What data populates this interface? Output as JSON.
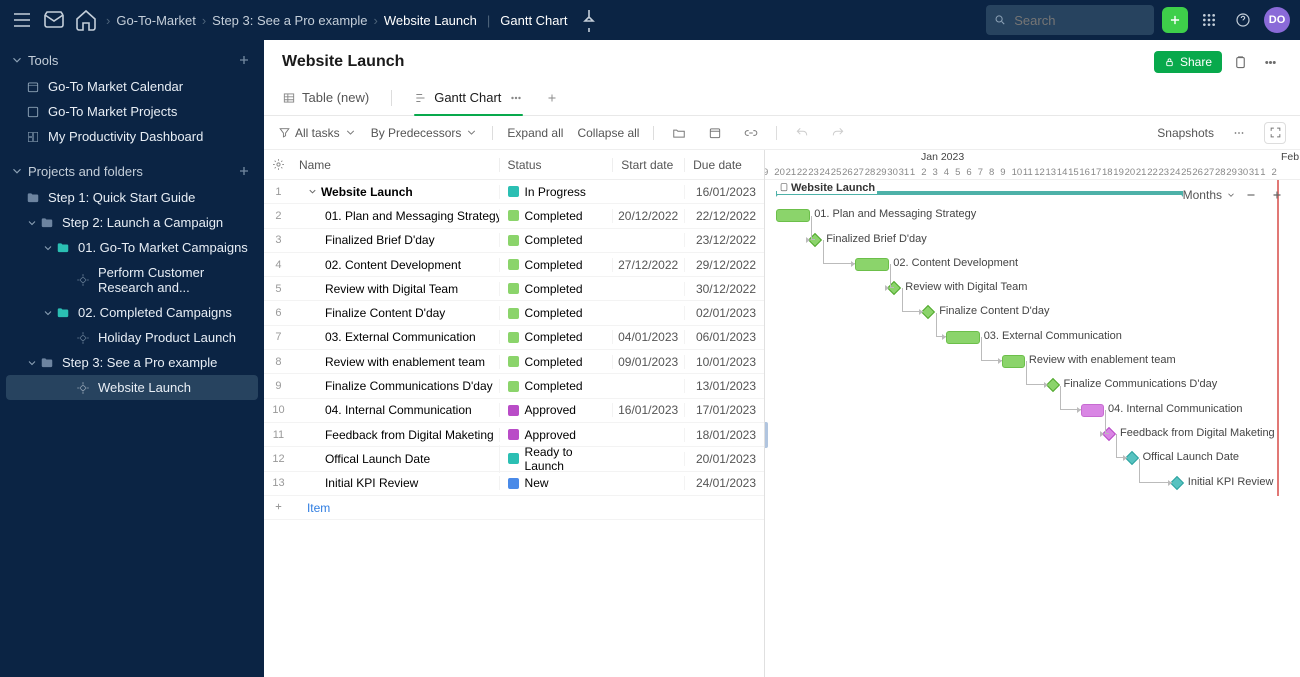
{
  "topbar": {
    "breadcrumbs": [
      "Go-To-Market",
      "Step 3: See a Pro example",
      "Website Launch"
    ],
    "view_divider": "|",
    "view_name": "Gantt Chart",
    "search_placeholder": "Search",
    "avatar_initials": "DO"
  },
  "sidebar": {
    "tools_label": "Tools",
    "tools_items": [
      "Go-To Market Calendar",
      "Go-To Market Projects",
      "My Productivity Dashboard"
    ],
    "projects_label": "Projects and folders",
    "step1": "Step 1: Quick Start Guide",
    "step2": "Step 2: Launch a Campaign",
    "step2_sub1": "01. Go-To Market Campaigns",
    "step2_sub1a": "Perform Customer Research and...",
    "step2_sub2": "02. Completed Campaigns",
    "step2_sub2a": "Holiday Product Launch",
    "step3": "Step 3: See a Pro example",
    "step3_sub1": "Website Launch"
  },
  "page": {
    "title": "Website Launch",
    "share_label": "Share",
    "tabs": {
      "table": "Table (new)",
      "gantt": "Gantt Chart"
    }
  },
  "toolbar": {
    "all_tasks": "All tasks",
    "by_pred": "By Predecessors",
    "expand_all": "Expand all",
    "collapse_all": "Collapse all",
    "snapshots": "Snapshots"
  },
  "grid_headers": {
    "name": "Name",
    "status": "Status",
    "start": "Start date",
    "due": "Due date"
  },
  "status_colors": {
    "In Progress": "#2bbfb3",
    "Completed": "#8bd46b",
    "Approved": "#b94cc7",
    "Ready to Launch": "#2bbfb3",
    "New": "#4a8ae8"
  },
  "rows": [
    {
      "n": 1,
      "name": "Website Launch",
      "status": "In Progress",
      "start": "",
      "due": "16/01/2023",
      "indent": 0,
      "parent": true
    },
    {
      "n": 2,
      "name": "01. Plan and Messaging Strategy",
      "status": "Completed",
      "start": "20/12/2022",
      "due": "22/12/2022",
      "indent": 1
    },
    {
      "n": 3,
      "name": "Finalized Brief D'day",
      "status": "Completed",
      "start": "",
      "due": "23/12/2022",
      "indent": 1
    },
    {
      "n": 4,
      "name": "02. Content Development",
      "status": "Completed",
      "start": "27/12/2022",
      "due": "29/12/2022",
      "indent": 1
    },
    {
      "n": 5,
      "name": "Review with Digital Team",
      "status": "Completed",
      "start": "",
      "due": "30/12/2022",
      "indent": 1
    },
    {
      "n": 6,
      "name": "Finalize Content D'day",
      "status": "Completed",
      "start": "",
      "due": "02/01/2023",
      "indent": 1
    },
    {
      "n": 7,
      "name": "03. External Communication",
      "status": "Completed",
      "start": "04/01/2023",
      "due": "06/01/2023",
      "indent": 1
    },
    {
      "n": 8,
      "name": "Review with enablement team",
      "status": "Completed",
      "start": "09/01/2023",
      "due": "10/01/2023",
      "indent": 1
    },
    {
      "n": 9,
      "name": "Finalize Communications D'day",
      "status": "Completed",
      "start": "",
      "due": "13/01/2023",
      "indent": 1
    },
    {
      "n": 10,
      "name": "04. Internal Communication",
      "status": "Approved",
      "start": "16/01/2023",
      "due": "17/01/2023",
      "indent": 1
    },
    {
      "n": 11,
      "name": "Feedback from Digital Maketing",
      "status": "Approved",
      "start": "",
      "due": "18/01/2023",
      "indent": 1
    },
    {
      "n": 12,
      "name": "Offical Launch Date",
      "status": "Ready to Launch",
      "start": "",
      "due": "20/01/2023",
      "indent": 1
    },
    {
      "n": 13,
      "name": "Initial KPI Review",
      "status": "New",
      "start": "",
      "due": "24/01/2023",
      "indent": 1
    }
  ],
  "add_item_label": "Item",
  "gantt": {
    "month_label": "Jan 2023",
    "feb_label": "Feb",
    "scale_label": "Months",
    "parent_label": "Website Launch"
  }
}
